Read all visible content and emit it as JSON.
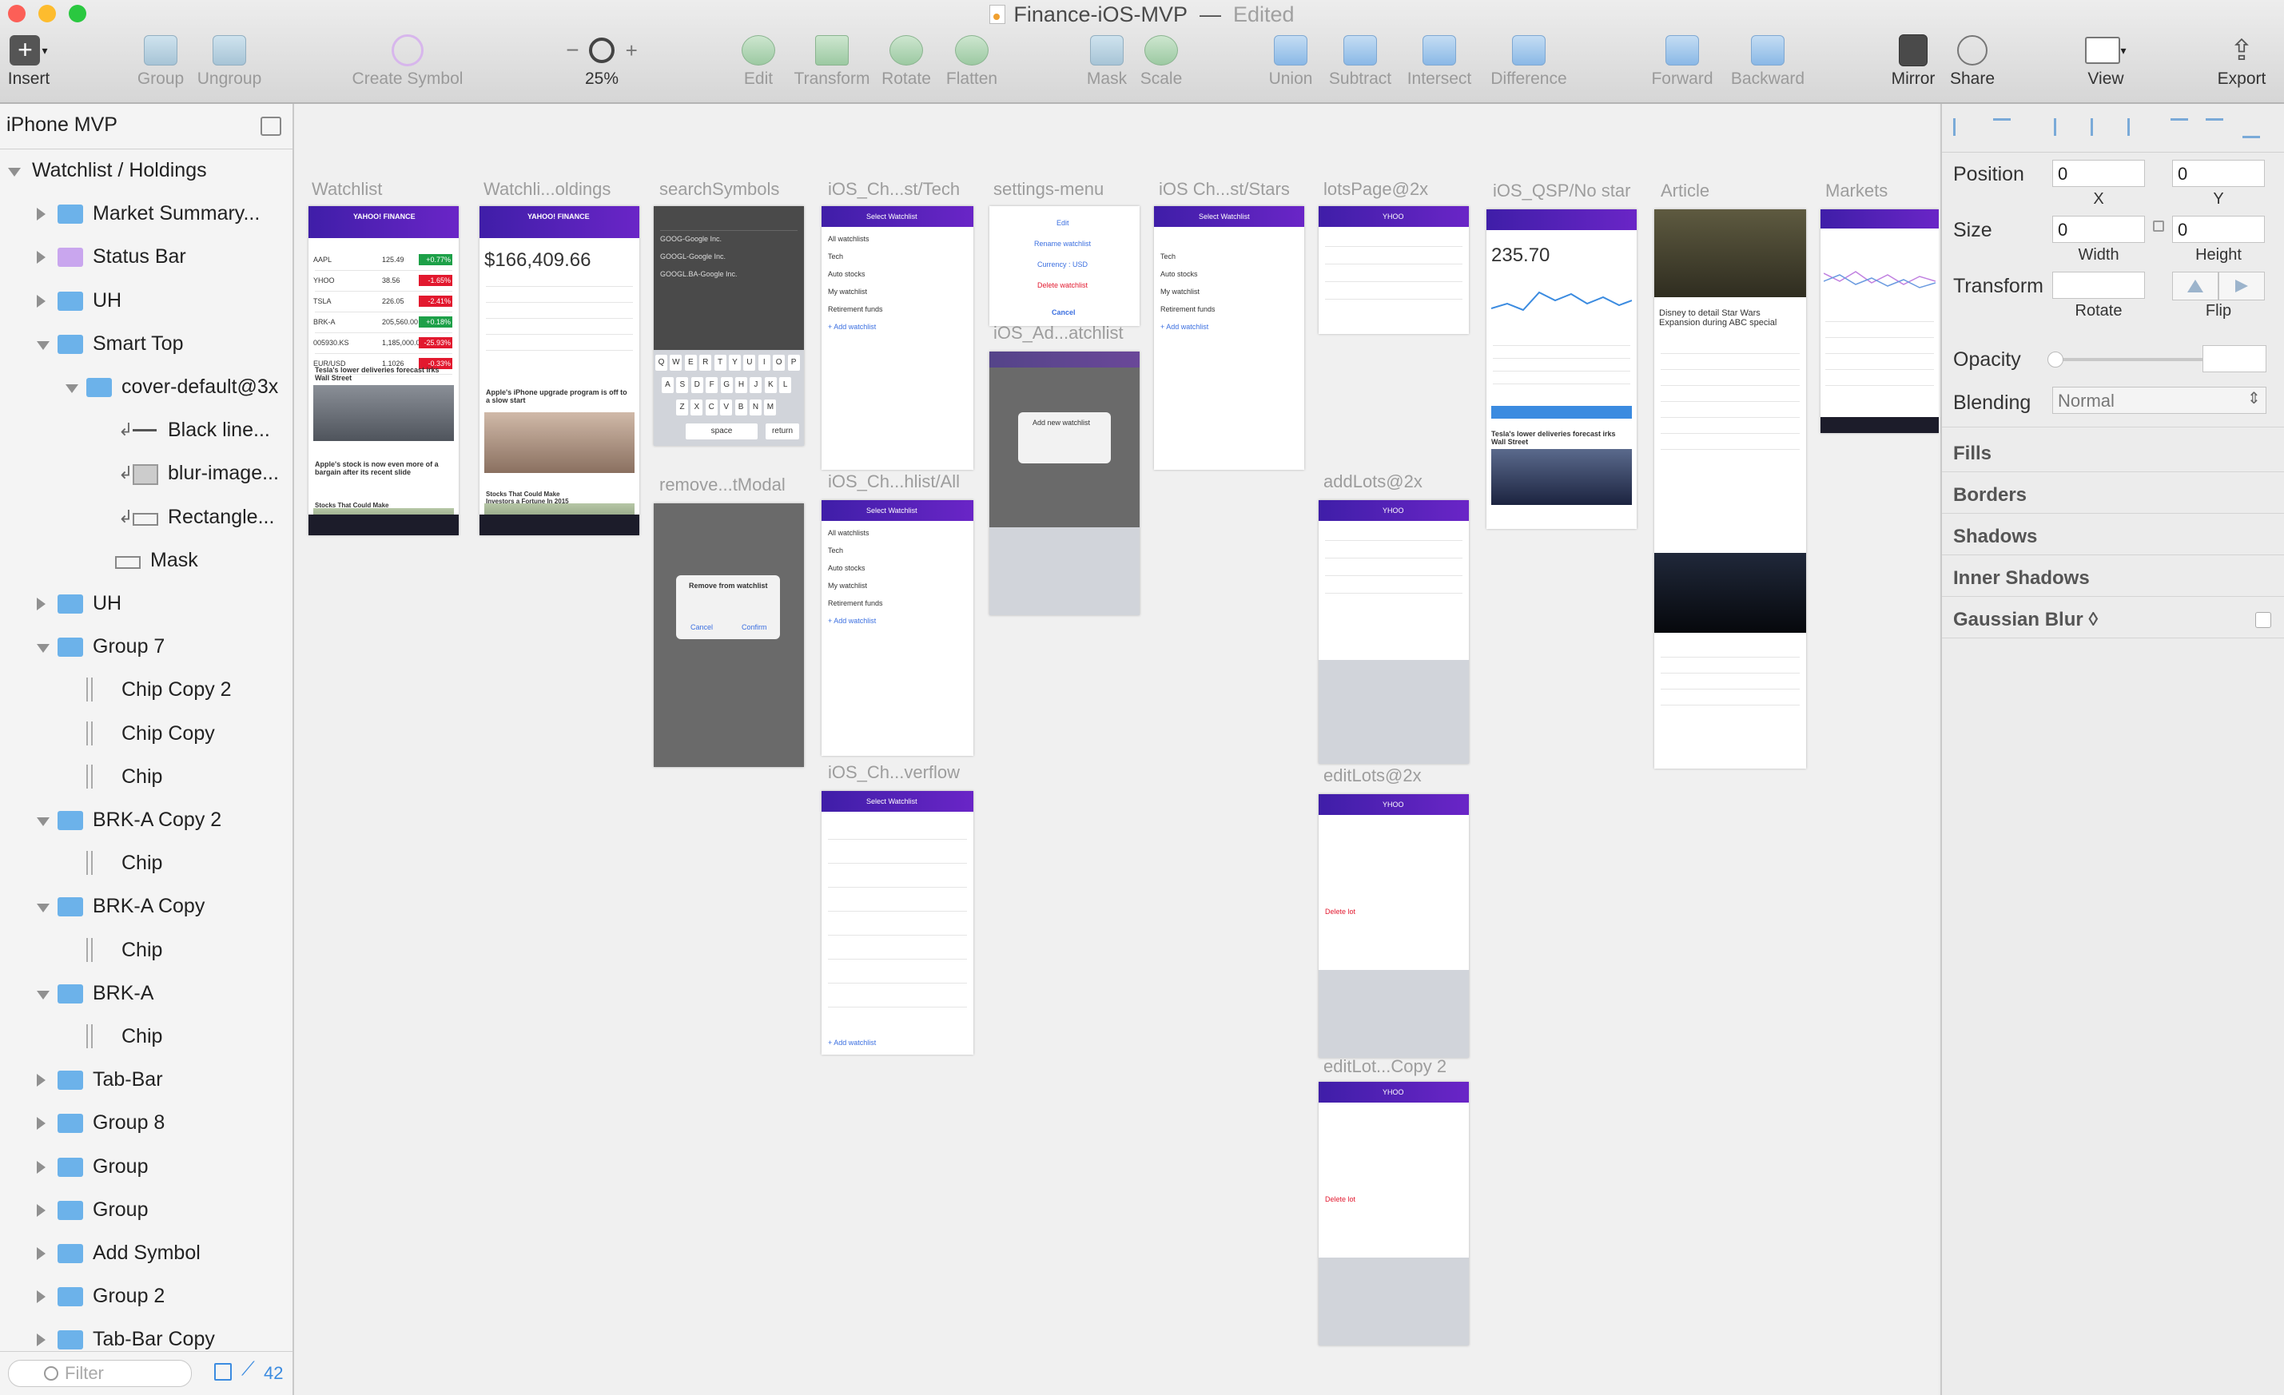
{
  "window": {
    "title": "Finance-iOS-MVP",
    "edited": "Edited"
  },
  "toolbar": {
    "insert": "Insert",
    "group": "Group",
    "ungroup": "Ungroup",
    "create_symbol": "Create Symbol",
    "zoom_minus": "−",
    "zoom_plus": "+",
    "zoom_value": "25%",
    "edit": "Edit",
    "transform": "Transform",
    "rotate": "Rotate",
    "flatten": "Flatten",
    "mask": "Mask",
    "scale": "Scale",
    "union": "Union",
    "subtract": "Subtract",
    "intersect": "Intersect",
    "difference": "Difference",
    "forward": "Forward",
    "backward": "Backward",
    "mirror": "Mirror",
    "share": "Share",
    "view": "View",
    "export": "Export"
  },
  "layers": {
    "page": "iPhone MVP",
    "items": [
      {
        "label": "Watchlist / Holdings"
      },
      {
        "label": "Market Summary..."
      },
      {
        "label": "Status Bar"
      },
      {
        "label": "UH"
      },
      {
        "label": "Smart Top"
      },
      {
        "label": "cover-default@3x"
      },
      {
        "label": "Black line..."
      },
      {
        "label": "blur-image..."
      },
      {
        "label": "Rectangle..."
      },
      {
        "label": "Mask"
      },
      {
        "label": "UH"
      },
      {
        "label": "Group 7"
      },
      {
        "label": "Chip Copy 2"
      },
      {
        "label": "Chip Copy"
      },
      {
        "label": "Chip"
      },
      {
        "label": "BRK-A Copy 2"
      },
      {
        "label": "Chip"
      },
      {
        "label": "BRK-A Copy"
      },
      {
        "label": "Chip"
      },
      {
        "label": "BRK-A"
      },
      {
        "label": "Chip"
      },
      {
        "label": "Tab-Bar"
      },
      {
        "label": "Group 8"
      },
      {
        "label": "Group"
      },
      {
        "label": "Group"
      },
      {
        "label": "Add Symbol"
      },
      {
        "label": "Group 2"
      },
      {
        "label": "Tab-Bar Copy"
      }
    ],
    "filter_placeholder": "Filter",
    "count": "42"
  },
  "artboards": [
    {
      "title": "Watchlist"
    },
    {
      "title": "Watchli...oldings"
    },
    {
      "title": "searchSymbols"
    },
    {
      "title": "iOS_Ch...st/Tech"
    },
    {
      "title": "settings-menu"
    },
    {
      "title": "iOS Ch...st/Stars"
    },
    {
      "title": "lotsPage@2x"
    },
    {
      "title": "iOS_QSP/No star"
    },
    {
      "title": "Article"
    },
    {
      "title": "Markets"
    },
    {
      "title": "remove...tModal"
    },
    {
      "title": "iOS_Ch...hlist/All"
    },
    {
      "title": "iOS_Ad...atchlist"
    },
    {
      "title": "addLots@2x"
    },
    {
      "title": "iOS_Ch...verflow"
    },
    {
      "title": "editLots@2x"
    },
    {
      "title": "editLot...Copy 2"
    }
  ],
  "mock": {
    "brand": "YAHOO! FINANCE",
    "holdings_value": "$166,409.66",
    "quote_price": "235.70",
    "watchlist_rows": [
      {
        "sym": "AAPL",
        "price": "125.49",
        "chg": "+0.77%",
        "up": true
      },
      {
        "sym": "YHOO",
        "price": "38.56",
        "chg": "-1.65%",
        "up": false
      },
      {
        "sym": "TSLA",
        "price": "226.05",
        "chg": "-2.41%",
        "up": false
      },
      {
        "sym": "BRK-A",
        "price": "205,560.00",
        "chg": "+0.18%",
        "up": true
      },
      {
        "sym": "005930.KS",
        "price": "1,185,000.00",
        "chg": "-25.93%",
        "up": false
      },
      {
        "sym": "EUR/USD",
        "price": "1.1026",
        "chg": "-0.33%",
        "up": false
      }
    ],
    "news_1": "Tesla's lower deliveries forecast irks Wall Street",
    "news_2": "Apple's stock is now even more of a bargain after its recent slide",
    "news_3": "Stocks That Could Make Investors a Fortune In 2015",
    "news_4": "Apple's iPhone upgrade program is off to a slow start",
    "article_title": "Disney to detail Star Wars Expansion during ABC special",
    "remove_title": "Remove from watchlist",
    "cancel": "Cancel",
    "confirm": "Confirm",
    "select_watchlist": "Select Watchlist",
    "settings_items": [
      "Edit",
      "Rename watchlist",
      "Currency : USD",
      "Delete watchlist",
      "Cancel"
    ],
    "watchlists": [
      "All watchlists",
      "Tech",
      "Auto stocks",
      "My watchlist",
      "Retirement funds"
    ],
    "add_watchlist": "+ Add watchlist",
    "ticker": "YHOO",
    "delete_lot": "Delete lot",
    "add_new_watchlist": "Add new watchlist",
    "keyboard_row1": [
      "Q",
      "W",
      "E",
      "R",
      "T",
      "Y",
      "U",
      "I",
      "O",
      "P"
    ],
    "keyboard_row2": [
      "A",
      "S",
      "D",
      "F",
      "G",
      "H",
      "J",
      "K",
      "L"
    ],
    "keyboard_row3": [
      "Z",
      "X",
      "C",
      "V",
      "B",
      "N",
      "M"
    ],
    "space": "space",
    "return": "return"
  },
  "inspector": {
    "position_label": "Position",
    "x_value": "0",
    "y_value": "0",
    "x_label": "X",
    "y_label": "Y",
    "size_label": "Size",
    "width_value": "0",
    "height_value": "0",
    "width_label": "Width",
    "height_label": "Height",
    "transform_label": "Transform",
    "rotate_label": "Rotate",
    "flip_label": "Flip",
    "opacity_label": "Opacity",
    "blending_label": "Blending",
    "blending_value": "Normal",
    "fills": "Fills",
    "borders": "Borders",
    "shadows": "Shadows",
    "inner_shadows": "Inner Shadows",
    "gaussian_blur": "Gaussian Blur ◊"
  },
  "colors": {
    "accent_purple": "#5a22bd",
    "folder_blue": "#6cb2ea",
    "up_green": "#1da048",
    "down_red": "#e2182e"
  }
}
